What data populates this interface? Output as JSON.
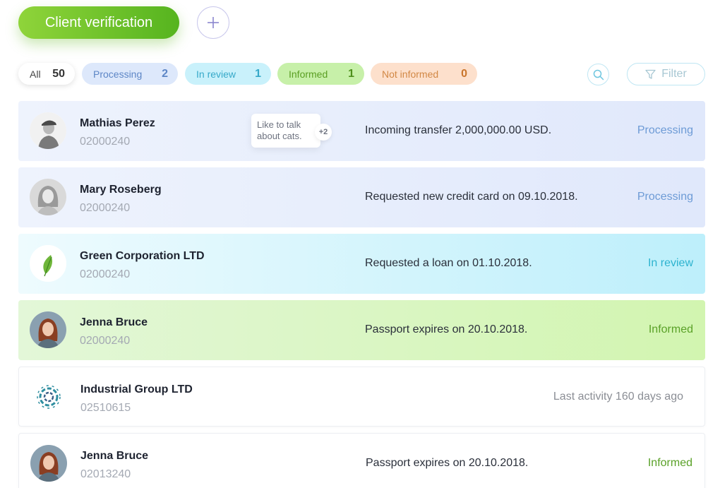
{
  "header": {
    "verification_label": "Client verification",
    "add_icon": "plus-icon"
  },
  "filters": {
    "all": {
      "label": "All",
      "count": "50"
    },
    "processing": {
      "label": "Processing",
      "count": "2"
    },
    "in_review": {
      "label": "In review",
      "count": "1"
    },
    "informed": {
      "label": "Informed",
      "count": "1"
    },
    "not_informed": {
      "label": "Not informed",
      "count": "0"
    },
    "search_icon": "search-icon",
    "filter_label": "Filter",
    "filter_icon": "funnel-icon"
  },
  "colors": {
    "accent_green": "#56b41f",
    "processing": "#6d9bd6",
    "in_review": "#2db3cf",
    "informed": "#5aa128",
    "not_informed": "#d28845"
  },
  "clients": [
    {
      "name": "Mathias Perez",
      "id": "02000240",
      "note": "Like to talk about cats.",
      "note_more": "+2",
      "activity": "Incoming transfer 2,000,000.00 USD.",
      "status": "Processing",
      "avatar": "man-with-cap-photo"
    },
    {
      "name": "Mary Roseberg",
      "id": "02000240",
      "activity": "Requested new credit card on 09.10.2018.",
      "status": "Processing",
      "avatar": "woman-portrait-photo"
    },
    {
      "name": "Green Corporation LTD",
      "id": "02000240",
      "activity": "Requested a loan on 01.10.2018.",
      "status": "In review",
      "avatar": "leaf-logo-icon"
    },
    {
      "name": "Jenna Bruce",
      "id": "02000240",
      "activity": "Passport expires on 20.10.2018.",
      "status": "Informed",
      "avatar": "woman-red-hair-photo"
    },
    {
      "name": "Industrial Group LTD",
      "id": "02510615",
      "activity": "Last activity 160 days ago",
      "status": "",
      "avatar": "gear-logo-icon"
    },
    {
      "name": "Jenna Bruce",
      "id": "02013240",
      "activity": "Passport expires on 20.10.2018.",
      "status": "Informed",
      "avatar": "woman-red-hair-photo"
    }
  ]
}
